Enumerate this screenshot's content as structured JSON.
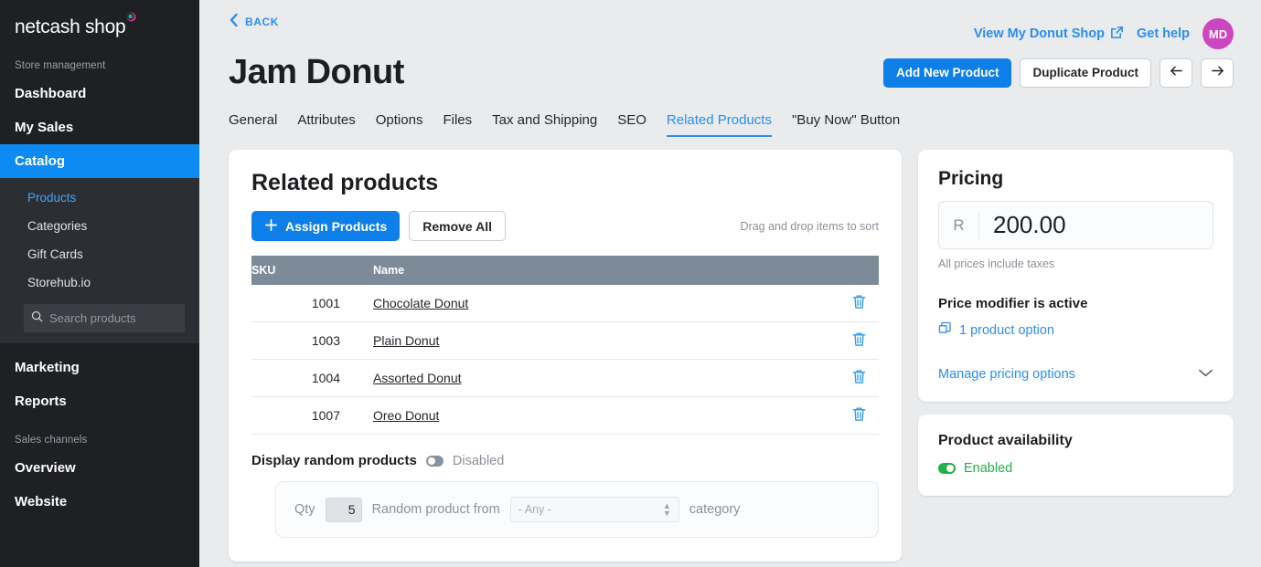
{
  "sidebar": {
    "brand": "netcash shop",
    "store_label": "Store management",
    "items": [
      {
        "label": "Dashboard"
      },
      {
        "label": "My Sales"
      },
      {
        "label": "Catalog"
      }
    ],
    "sub_items": [
      {
        "label": "Products"
      },
      {
        "label": "Categories"
      },
      {
        "label": "Gift Cards"
      },
      {
        "label": "Storehub.io"
      }
    ],
    "search": {
      "placeholder": "Search products",
      "value": "",
      "icon": "search-icon"
    },
    "items_2": [
      {
        "label": "Marketing"
      },
      {
        "label": "Reports"
      }
    ],
    "channels_label": "Sales channels",
    "items_3": [
      {
        "label": "Overview"
      },
      {
        "label": "Website"
      }
    ]
  },
  "header": {
    "back_label": "BACK",
    "title": "Jam Donut",
    "view_shop_label": "View My Donut Shop",
    "external_icon": "external-link-icon",
    "get_help_label": "Get help",
    "avatar_initials": "MD",
    "add_new_label": "Add New Product",
    "duplicate_label": "Duplicate Product",
    "prev_icon": "arrow-left-icon",
    "next_icon": "arrow-right-icon"
  },
  "tabs": [
    {
      "label": "General",
      "active": false
    },
    {
      "label": "Attributes",
      "active": false
    },
    {
      "label": "Options",
      "active": false
    },
    {
      "label": "Files",
      "active": false
    },
    {
      "label": "Tax and Shipping",
      "active": false
    },
    {
      "label": "SEO",
      "active": false
    },
    {
      "label": "Related Products",
      "active": true
    },
    {
      "label": "\"Buy Now\" Button",
      "active": false
    }
  ],
  "related": {
    "title": "Related products",
    "assign_label": "Assign Products",
    "remove_all_label": "Remove All",
    "drag_hint": "Drag and drop items to sort",
    "columns": {
      "sku": "SKU",
      "name": "Name"
    },
    "rows": [
      {
        "sku": "1001",
        "name": "Chocolate Donut"
      },
      {
        "sku": "1003",
        "name": "Plain Donut"
      },
      {
        "sku": "1004",
        "name": "Assorted Donut"
      },
      {
        "sku": "1007",
        "name": "Oreo Donut"
      }
    ],
    "random": {
      "label": "Display random products",
      "state": "Disabled",
      "qty_label": "Qty",
      "qty_value": "5",
      "from_label": "Random product from",
      "category_value": "- Any -",
      "category_label": "category"
    }
  },
  "pricing": {
    "title": "Pricing",
    "currency": "R",
    "amount": "200.00",
    "tax_note": "All prices include taxes",
    "modifier_title": "Price modifier is active",
    "option_count_label": "1 product option",
    "option_icon": "copy-stack-icon",
    "manage_label": "Manage pricing options",
    "chevron_icon": "chevron-down-icon"
  },
  "availability": {
    "title": "Product availability",
    "state": "Enabled"
  },
  "colors": {
    "accent_blue": "#0e7fe8",
    "link_blue": "#2b8ef0",
    "sidebar_bg": "#1e2023",
    "sidebar_sub_bg": "#2b2e33",
    "active_nav": "#0d8bf2",
    "table_header": "#7d8b99",
    "avatar": "#cc46c0",
    "green": "#22b14c",
    "page_bg": "#e9ebed"
  }
}
